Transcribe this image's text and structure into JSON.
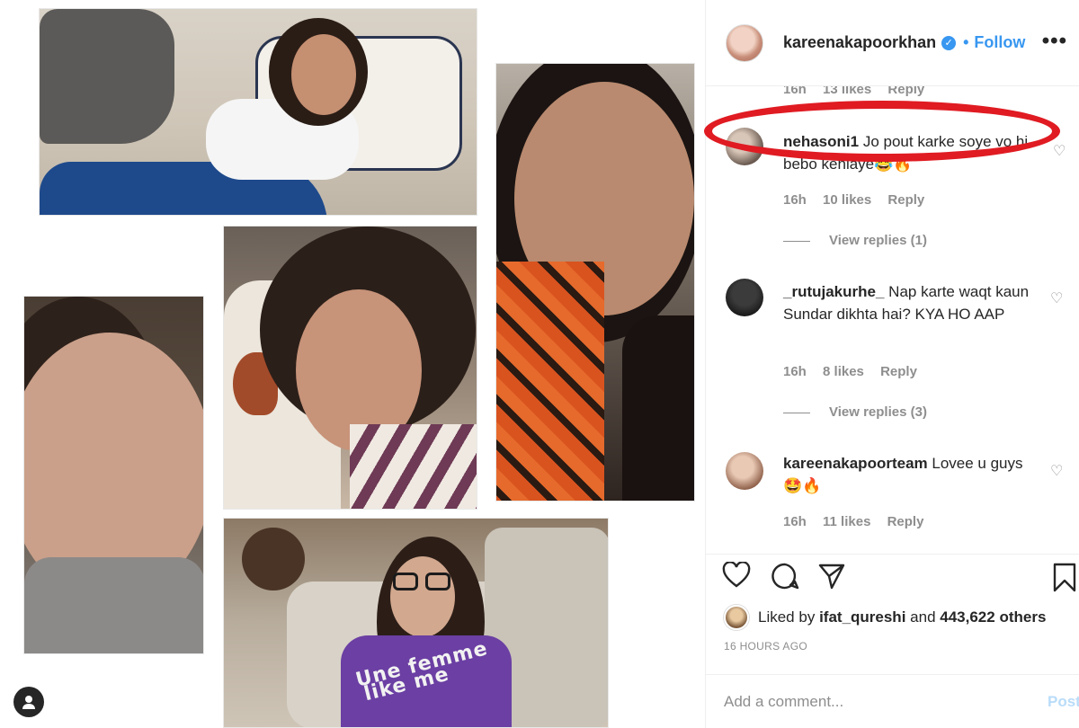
{
  "colors": {
    "accent": "#3897f0",
    "highlight": "#e01b22",
    "muted": "#8e8e8e"
  },
  "header": {
    "username": "kareenakapoorkhan",
    "verified_icon": "verified-badge-icon",
    "separator": "•",
    "follow_label": "Follow",
    "more_label": "•••"
  },
  "comments": {
    "partial_top": {
      "time": "16h",
      "likes": "13 likes",
      "reply": "Reply"
    },
    "items": [
      {
        "username": "nehasoni1",
        "text": "Jo pout karke soye vo hi bebo kehlaye😂🔥",
        "time": "16h",
        "likes": "10 likes",
        "reply": "Reply",
        "view_replies": "View replies (1)"
      },
      {
        "username": "_rutujakurhe_",
        "text": "Nap karte waqt kaun Sundar dikhta hai? KYA HO AAP",
        "time": "16h",
        "likes": "8 likes",
        "reply": "Reply",
        "view_replies": "View replies (3)"
      },
      {
        "username": "kareenakapoorteam",
        "text": "Lovee u guys 🤩🔥",
        "time": "16h",
        "likes": "11 likes",
        "reply": "Reply"
      }
    ]
  },
  "actions": {
    "liked_prefix": "Liked by",
    "liked_user": "ifat_qureshi",
    "liked_and": "and",
    "liked_others": "443,622 others",
    "time_ago": "16 HOURS AGO"
  },
  "composer": {
    "placeholder": "Add a comment...",
    "post_label": "Post"
  },
  "collage": {
    "shirt_text_1": "Une femme",
    "shirt_text_2": "like me"
  }
}
